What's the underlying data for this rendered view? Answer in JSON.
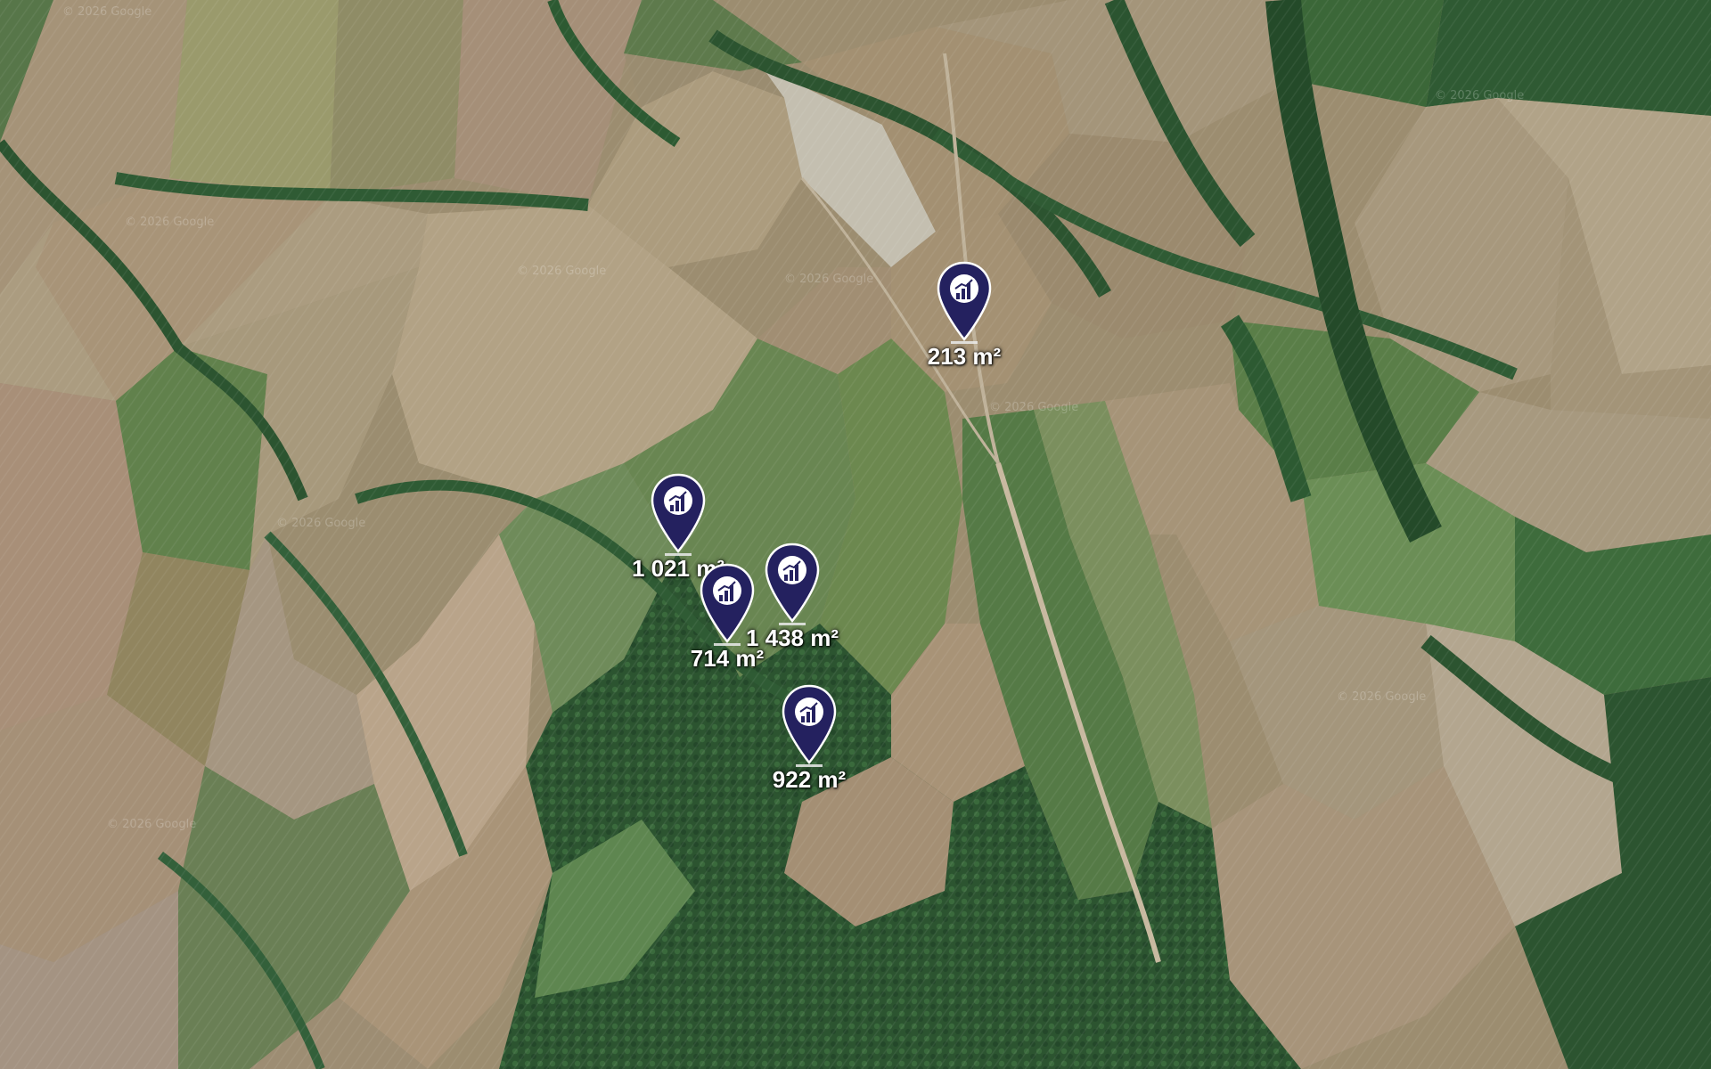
{
  "map": {
    "type": "satellite",
    "watermark": "© 2026 Google"
  },
  "colors": {
    "pin_fill": "#24215f",
    "pin_icon": "#ffffff",
    "label_text": "#ffffff",
    "field_tan": "#a9957a",
    "field_green": "#6e8a55",
    "forest": "#2d5a32"
  },
  "markers": [
    {
      "icon": "parcel-chart-icon",
      "area_label": "213 m²"
    },
    {
      "icon": "parcel-chart-icon",
      "area_label": "1 021 m²"
    },
    {
      "icon": "parcel-chart-icon",
      "area_label": "1 438 m²"
    },
    {
      "icon": "parcel-chart-icon",
      "area_label": "714 m²"
    },
    {
      "icon": "parcel-chart-icon",
      "area_label": "922 m²"
    }
  ]
}
